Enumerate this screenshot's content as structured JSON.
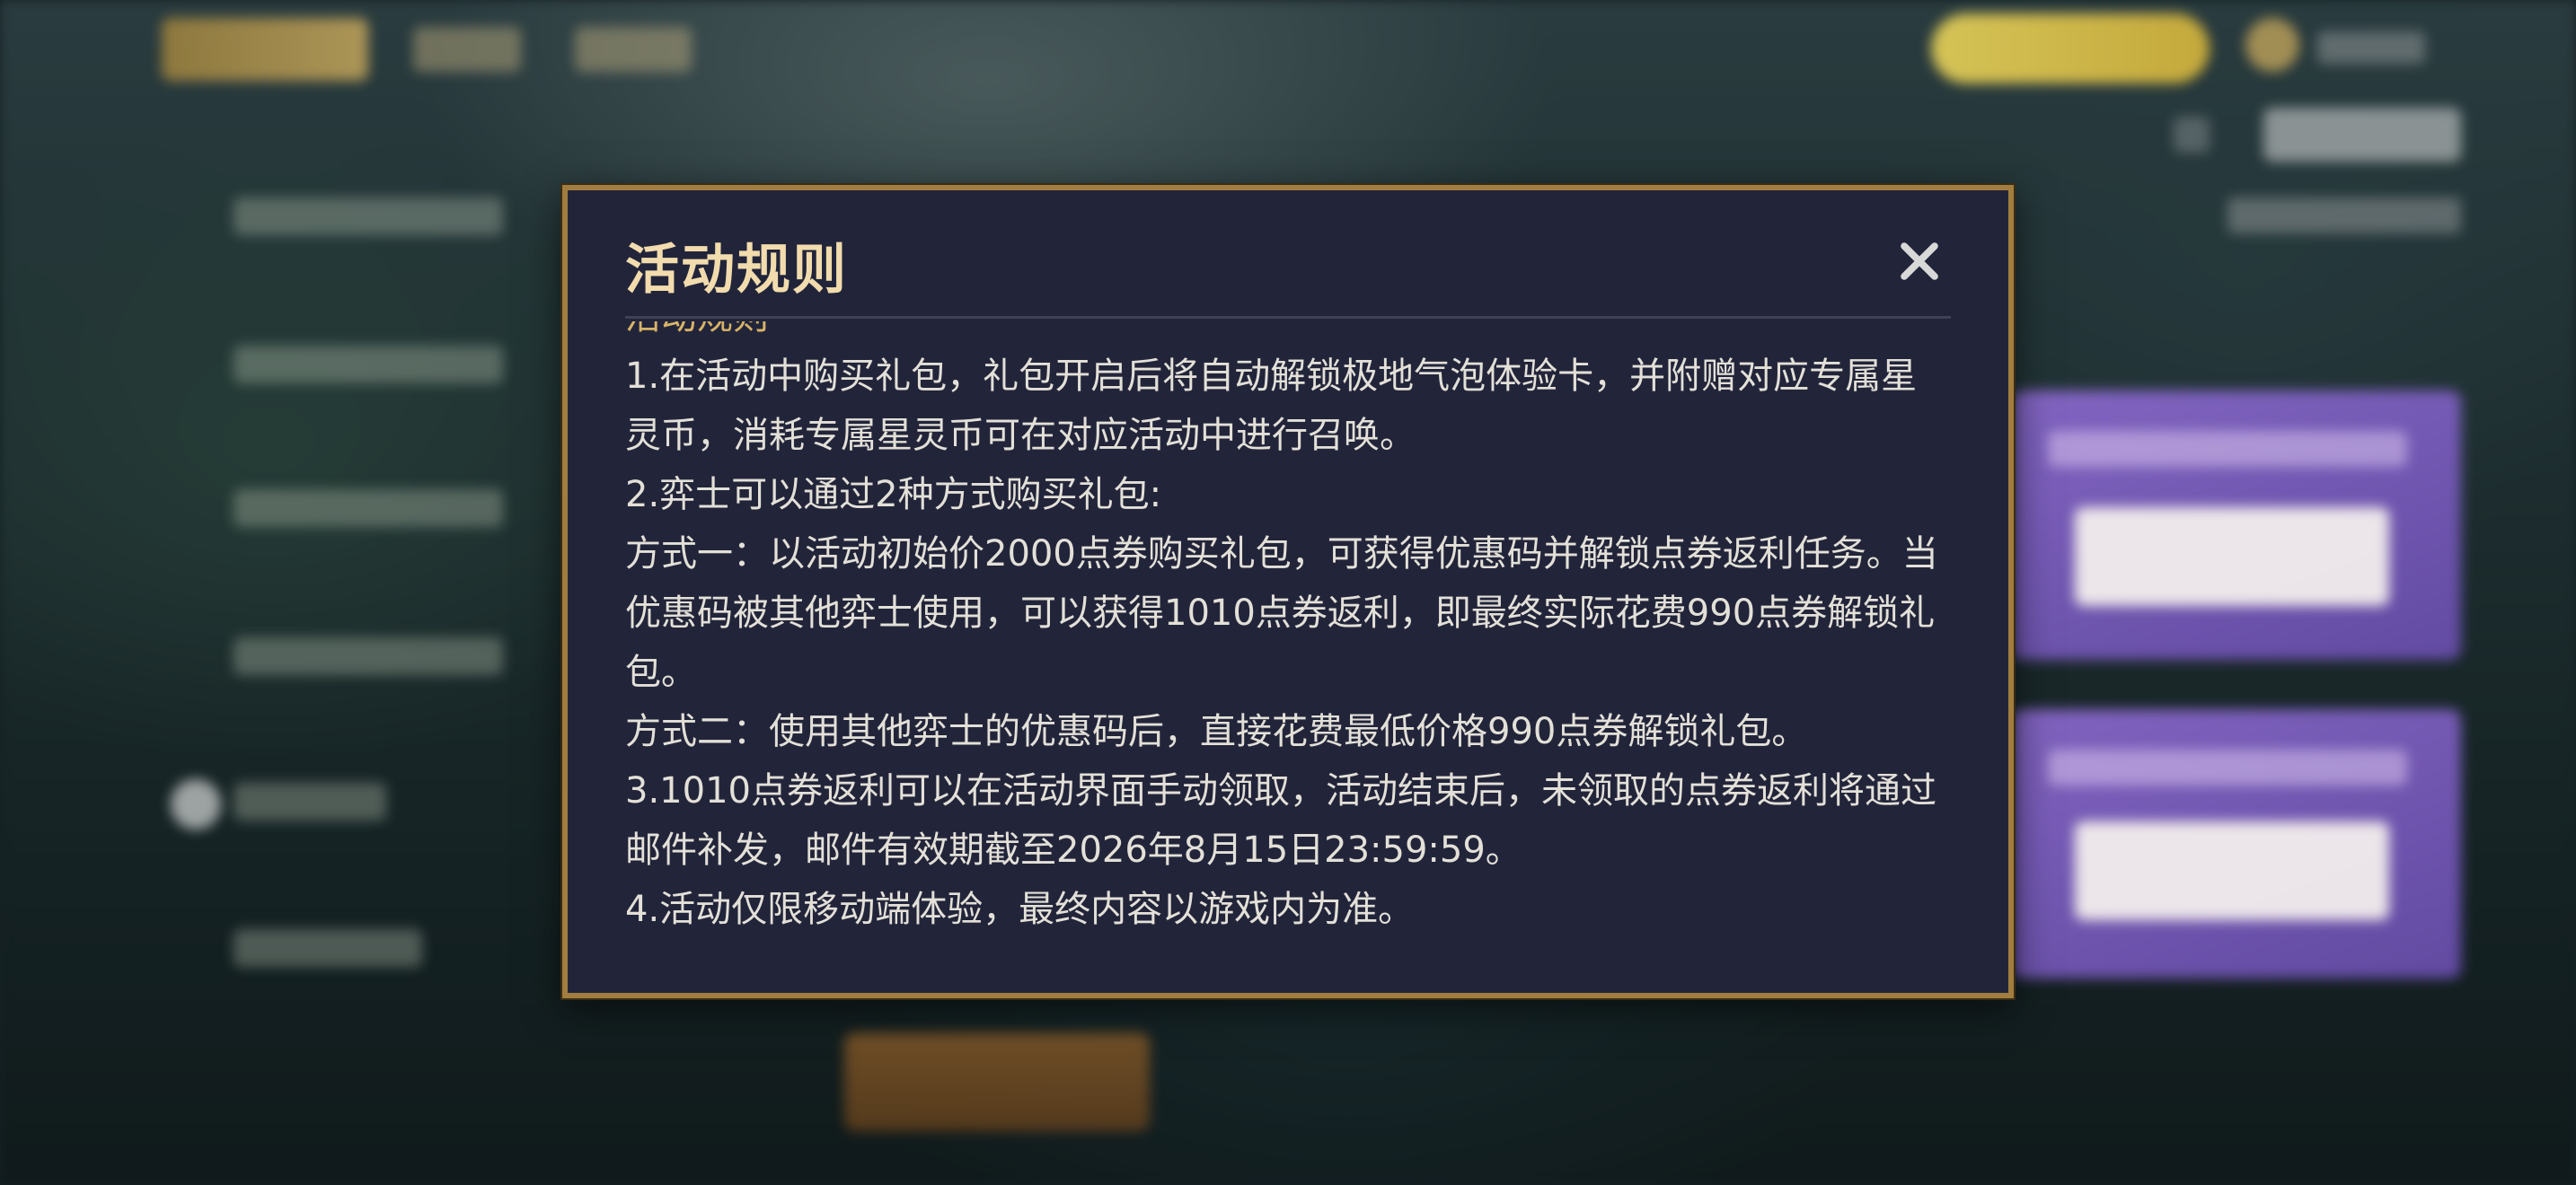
{
  "modal": {
    "title": "活动规则",
    "subtitle": "活动规则",
    "close_icon": "close-icon",
    "rules": [
      "1.在活动中购买礼包，礼包开启后将自动解锁极地气泡体验卡，并附赠对应专属星灵币，消耗专属星灵币可在对应活动中进行召唤。",
      "2.弈士可以通过2种方式购买礼包:",
      "方式一：以活动初始价2000点券购买礼包，可获得优惠码并解锁点券返利任务。当优惠码被其他弈士使用，可以获得1010点券返利，即最终实际花费990点券解锁礼包。",
      "方式二：使用其他弈士的优惠码后，直接花费最低价格990点券解锁礼包。",
      "3.1010点券返利可以在活动界面手动领取，活动结束后，未领取的点券返利将通过邮件补发，邮件有效期截至2026年8月15日23:59:59。",
      "4.活动仅限移动端体验，最终内容以游戏内为准。"
    ]
  },
  "colors": {
    "modal_bg": "#22253a",
    "modal_border": "#a17d3f",
    "title": "#f2dcae",
    "body_text": "#e3e0d8"
  }
}
